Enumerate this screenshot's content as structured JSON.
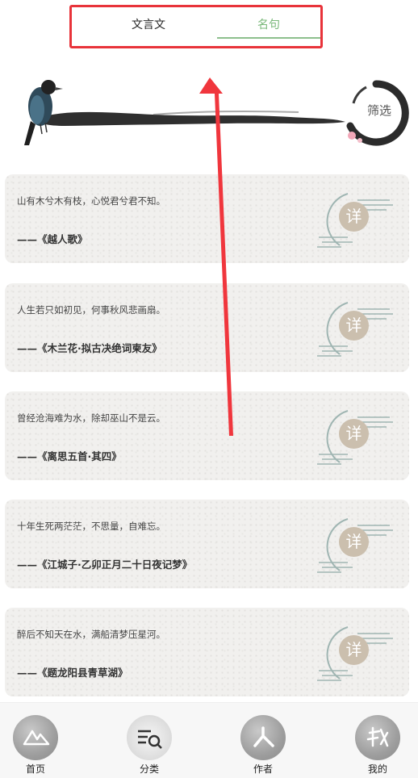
{
  "tabs": [
    {
      "label": "文言文",
      "active": false
    },
    {
      "label": "名句",
      "active": true
    }
  ],
  "filter": {
    "label": "筛选"
  },
  "cards": [
    {
      "quote": "山有木兮木有枝，心悦君兮君不知。",
      "source": "——《越人歌》",
      "detail": "详"
    },
    {
      "quote": "人生若只如初见，何事秋风悲画扇。",
      "source": "——《木兰花·拟古决绝词柬友》",
      "detail": "详"
    },
    {
      "quote": "曾经沧海难为水，除却巫山不是云。",
      "source": "——《离思五首·其四》",
      "detail": "详"
    },
    {
      "quote": "十年生死两茫茫，不思量，自难忘。",
      "source": "——《江城子·乙卯正月二十日夜记梦》",
      "detail": "详"
    },
    {
      "quote": "醉后不知天在水，满船清梦压星河。",
      "source": "——《题龙阳县青草湖》",
      "detail": "详"
    }
  ],
  "nav": [
    {
      "label": "首页",
      "icon": "mountain-icon"
    },
    {
      "label": "分类",
      "icon": "category-search-icon"
    },
    {
      "label": "作者",
      "icon": "person-icon"
    },
    {
      "label": "我的",
      "icon": "me-icon"
    }
  ],
  "colors": {
    "accent_green": "#8dc08d",
    "highlight_red": "#e8333a",
    "detail_badge": "#cbbfae"
  }
}
